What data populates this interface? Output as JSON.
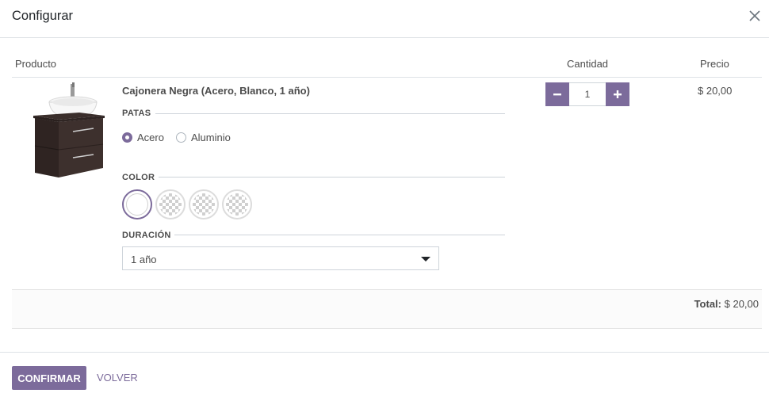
{
  "dialog": {
    "title": "Configurar"
  },
  "table": {
    "col_product": "Producto",
    "col_quantity": "Cantidad",
    "col_price": "Precio"
  },
  "product": {
    "name": "Cajonera Negra (Acero, Blanco, 1 año)",
    "quantity": "1",
    "price": "$ 20,00"
  },
  "attributes": {
    "legs": {
      "title": "PATAS",
      "options": [
        {
          "label": "Acero",
          "selected": true
        },
        {
          "label": "Aluminio",
          "selected": false
        }
      ]
    },
    "color": {
      "title": "COLOR",
      "swatches": [
        {
          "name": "Blanco",
          "color": "#ffffff",
          "selected": true
        },
        {
          "name": "swatch-2",
          "color": "transparent",
          "selected": false
        },
        {
          "name": "swatch-3",
          "color": "transparent",
          "selected": false
        },
        {
          "name": "swatch-4",
          "color": "transparent",
          "selected": false
        }
      ]
    },
    "duration": {
      "title": "DURACIÓN",
      "selected": "1 año"
    }
  },
  "total": {
    "label": "Total:",
    "value": "$ 20,00"
  },
  "footer": {
    "confirm": "CONFIRMAR",
    "back": "VOLVER"
  },
  "icons": [
    "close-icon",
    "minus-icon",
    "plus-icon",
    "chevron-down-icon"
  ],
  "colors": {
    "accent": "#7c6b9b",
    "text": "#4c4c4c",
    "border": "#dee2e6"
  }
}
